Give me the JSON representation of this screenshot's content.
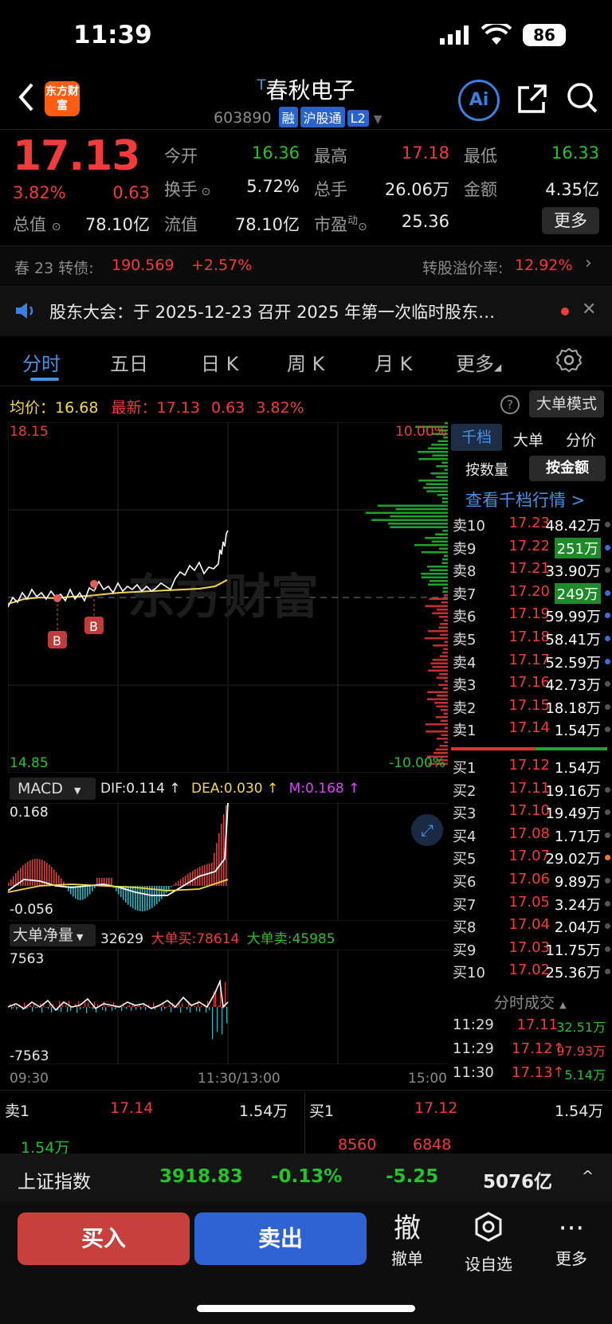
{
  "status": {
    "time": "11:39",
    "battery": "86"
  },
  "header": {
    "name": "春秋电子",
    "name_prefix": "T",
    "code": "603890",
    "tags": [
      "融",
      "沪股通",
      "L2"
    ],
    "logo": "东方财富"
  },
  "quote": {
    "price": "17.13",
    "pct": "3.82%",
    "chg": "0.63",
    "zongzhi_label": "总值",
    "zongzhi": "78.10亿",
    "fields": [
      {
        "label": "今开",
        "value": "16.36",
        "color": "green"
      },
      {
        "label": "最高",
        "value": "17.18",
        "color": "red"
      },
      {
        "label": "最低",
        "value": "16.33",
        "color": "green"
      },
      {
        "label": "换手",
        "value": "5.72%",
        "color": "white"
      },
      {
        "label": "总手",
        "value": "26.06万",
        "color": "white"
      },
      {
        "label": "金额",
        "value": "4.35亿",
        "color": "white"
      },
      {
        "label": "流值",
        "value": "78.10亿",
        "color": "white"
      },
      {
        "label": "市盈",
        "value": "25.36",
        "color": "white"
      }
    ],
    "pe_sup": "动",
    "more": "更多"
  },
  "bond": {
    "name": "春 23 转债:",
    "price": "190.569",
    "pct": "+2.57%",
    "premium_label": "转股溢价率:",
    "premium": "12.92%"
  },
  "notice": {
    "text": "股东大会：于 2025-12-23 召开 2025 年第一次临时股东…"
  },
  "tabs": [
    "分时",
    "五日",
    "日 K",
    "周 K",
    "月 K",
    "更多"
  ],
  "chart_info": {
    "avg_label": "均价：",
    "avg": "16.68",
    "latest_label": "最新：",
    "latest": "17.13",
    "chg": "0.63",
    "pct": "3.82%",
    "big_mode": "大单模式",
    "y_top": "18.15",
    "y_bottom": "14.85",
    "pct_top": "10.00%",
    "pct_bottom": "-10.00%",
    "watermark": "东方财富",
    "b_marker": "B"
  },
  "macd": {
    "name": "MACD",
    "dif": "DIF:0.114 ↑",
    "dea": "DEA:0.030 ↑",
    "m": "M:0.168 ↑",
    "y_top": "0.168",
    "y_bottom": "-0.056"
  },
  "bigorder": {
    "name": "大单净量",
    "net": "32629",
    "buy": "大单买:78614",
    "sell": "大单卖:45985",
    "y_top": "7563",
    "y_bottom": "-7563"
  },
  "time_axis": [
    "09:30",
    "11:30/13:00",
    "15:00"
  ],
  "orderbook": {
    "tabs": [
      "千档",
      "大单",
      "分价"
    ],
    "sub_tabs": [
      "按数量",
      "按金额"
    ],
    "link": "查看千档行情 >",
    "asks": [
      {
        "label": "卖10",
        "price": "17.23",
        "vol": "48.42万",
        "hl": false,
        "dot": "gray"
      },
      {
        "label": "卖9",
        "price": "17.22",
        "vol": "251万",
        "hl": true,
        "dot": "blue"
      },
      {
        "label": "卖8",
        "price": "17.21",
        "vol": "33.90万",
        "hl": false,
        "dot": "gray"
      },
      {
        "label": "卖7",
        "price": "17.20",
        "vol": "249万",
        "hl": true,
        "dot": "blue"
      },
      {
        "label": "卖6",
        "price": "17.19",
        "vol": "59.99万",
        "hl": false,
        "dot": "blue"
      },
      {
        "label": "卖5",
        "price": "17.18",
        "vol": "58.41万",
        "hl": false,
        "dot": "blue"
      },
      {
        "label": "卖4",
        "price": "17.17",
        "vol": "52.59万",
        "hl": false,
        "dot": "blue"
      },
      {
        "label": "卖3",
        "price": "17.16",
        "vol": "42.73万",
        "hl": false,
        "dot": "gray"
      },
      {
        "label": "卖2",
        "price": "17.15",
        "vol": "18.18万",
        "hl": false,
        "dot": "gray"
      },
      {
        "label": "卖1",
        "price": "17.14",
        "vol": "1.54万",
        "hl": false,
        "dot": "gray"
      }
    ],
    "bids": [
      {
        "label": "买1",
        "price": "17.12",
        "vol": "1.54万",
        "dot": "none"
      },
      {
        "label": "买2",
        "price": "17.11",
        "vol": "19.16万",
        "dot": "gray"
      },
      {
        "label": "买3",
        "price": "17.10",
        "vol": "19.49万",
        "dot": "gray"
      },
      {
        "label": "买4",
        "price": "17.08",
        "vol": "1.71万",
        "dot": "gray"
      },
      {
        "label": "买5",
        "price": "17.07",
        "vol": "29.02万",
        "dot": "orange"
      },
      {
        "label": "买6",
        "price": "17.06",
        "vol": "9.89万",
        "dot": "gray"
      },
      {
        "label": "买7",
        "price": "17.05",
        "vol": "3.24万",
        "dot": "gray"
      },
      {
        "label": "买8",
        "price": "17.04",
        "vol": "2.04万",
        "dot": "gray"
      },
      {
        "label": "买9",
        "price": "17.03",
        "vol": "11.75万",
        "dot": "gray"
      },
      {
        "label": "买10",
        "price": "17.02",
        "vol": "25.36万",
        "dot": "gray"
      }
    ],
    "trades_title": "分时成交",
    "trades": [
      {
        "time": "11:29",
        "price": "17.11",
        "vol": "32.51万",
        "dir": "green"
      },
      {
        "time": "11:29",
        "price": "17.12↑",
        "vol": "97.93万",
        "dir": "red"
      },
      {
        "time": "11:30",
        "price": "17.13↑",
        "vol": "5.14万",
        "dir": "green"
      }
    ]
  },
  "level1": {
    "sell_label": "卖1",
    "sell_price": "17.14",
    "sell_vol": "1.54万",
    "buy_label": "买1",
    "buy_price": "17.12",
    "buy_vol": "1.54万",
    "sub_left": "1.54万",
    "sub_mid1": "8560",
    "sub_mid2": "6848"
  },
  "index": {
    "name": "上证指数",
    "value": "3918.83",
    "pct": "-0.13%",
    "chg": "-5.25",
    "amount": "5076亿"
  },
  "actions": {
    "buy": "买入",
    "sell": "卖出",
    "cancel": "撤单",
    "cancel_icon": "撤",
    "watch": "设自选",
    "more": "更多"
  }
}
